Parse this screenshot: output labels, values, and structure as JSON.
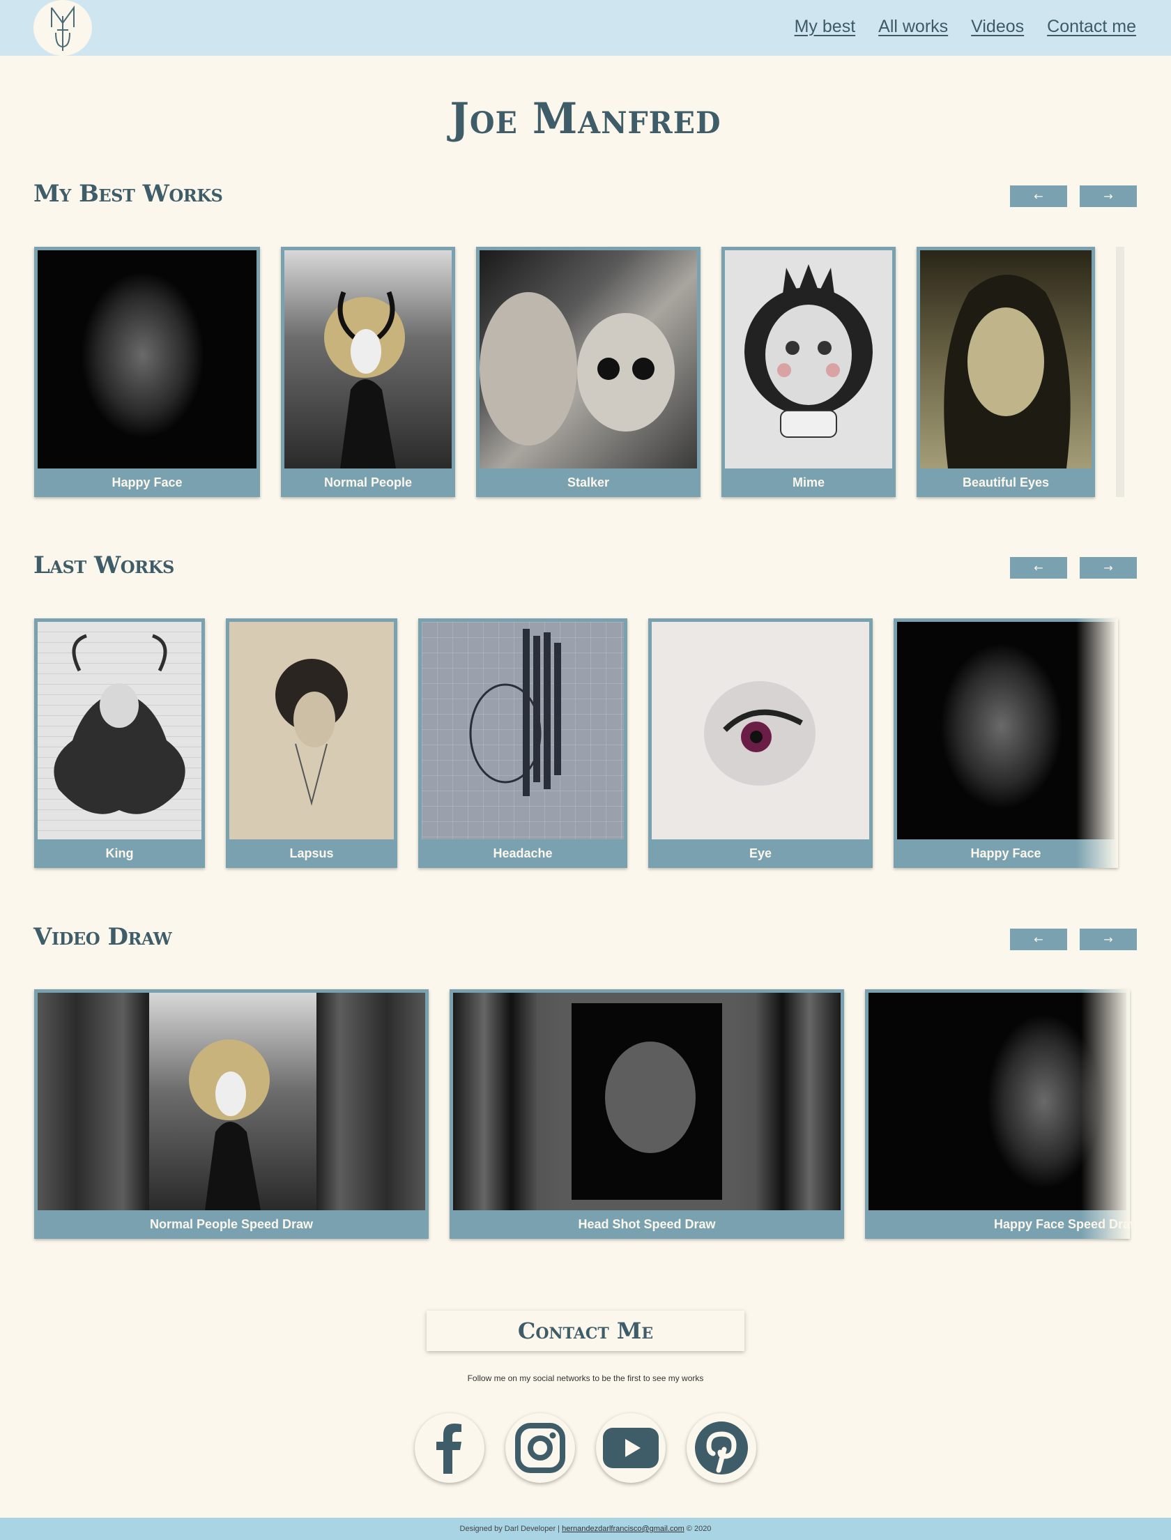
{
  "header": {
    "nav": [
      "My best",
      "All works",
      "Videos",
      "Contact me"
    ]
  },
  "site_title": "Joe Manfred",
  "sections": {
    "best": {
      "title": "My Best Works",
      "prev": "←",
      "next": "→",
      "cards": [
        "Happy Face",
        "Normal People",
        "Stalker",
        "Mime",
        "Beautiful Eyes"
      ]
    },
    "last": {
      "title": "Last Works",
      "prev": "←",
      "next": "→",
      "cards": [
        "King",
        "Lapsus",
        "Headache",
        "Eye",
        "Happy Face"
      ]
    },
    "video": {
      "title": "Video Draw",
      "prev": "←",
      "next": "→",
      "cards": [
        "Normal People Speed Draw",
        "Head Shot Speed Draw",
        "Happy Face Speed Draw"
      ]
    }
  },
  "contact": {
    "title": "Contact Me",
    "follow_text": "Follow me on my social networks to be the first to see my works",
    "social": [
      "facebook-icon",
      "instagram-icon",
      "youtube-icon",
      "pinterest-icon"
    ]
  },
  "footer": {
    "prefix": "Designed by Darl Developer |",
    "email": "hernandezdarlfrancisco@gmail.com",
    "suffix": "© 2020"
  },
  "colors": {
    "background": "#fbf7ec",
    "header": "#cfe6f0",
    "accent": "#7aa1b0",
    "title": "#3f5d69",
    "footer": "#a8d4e3"
  }
}
